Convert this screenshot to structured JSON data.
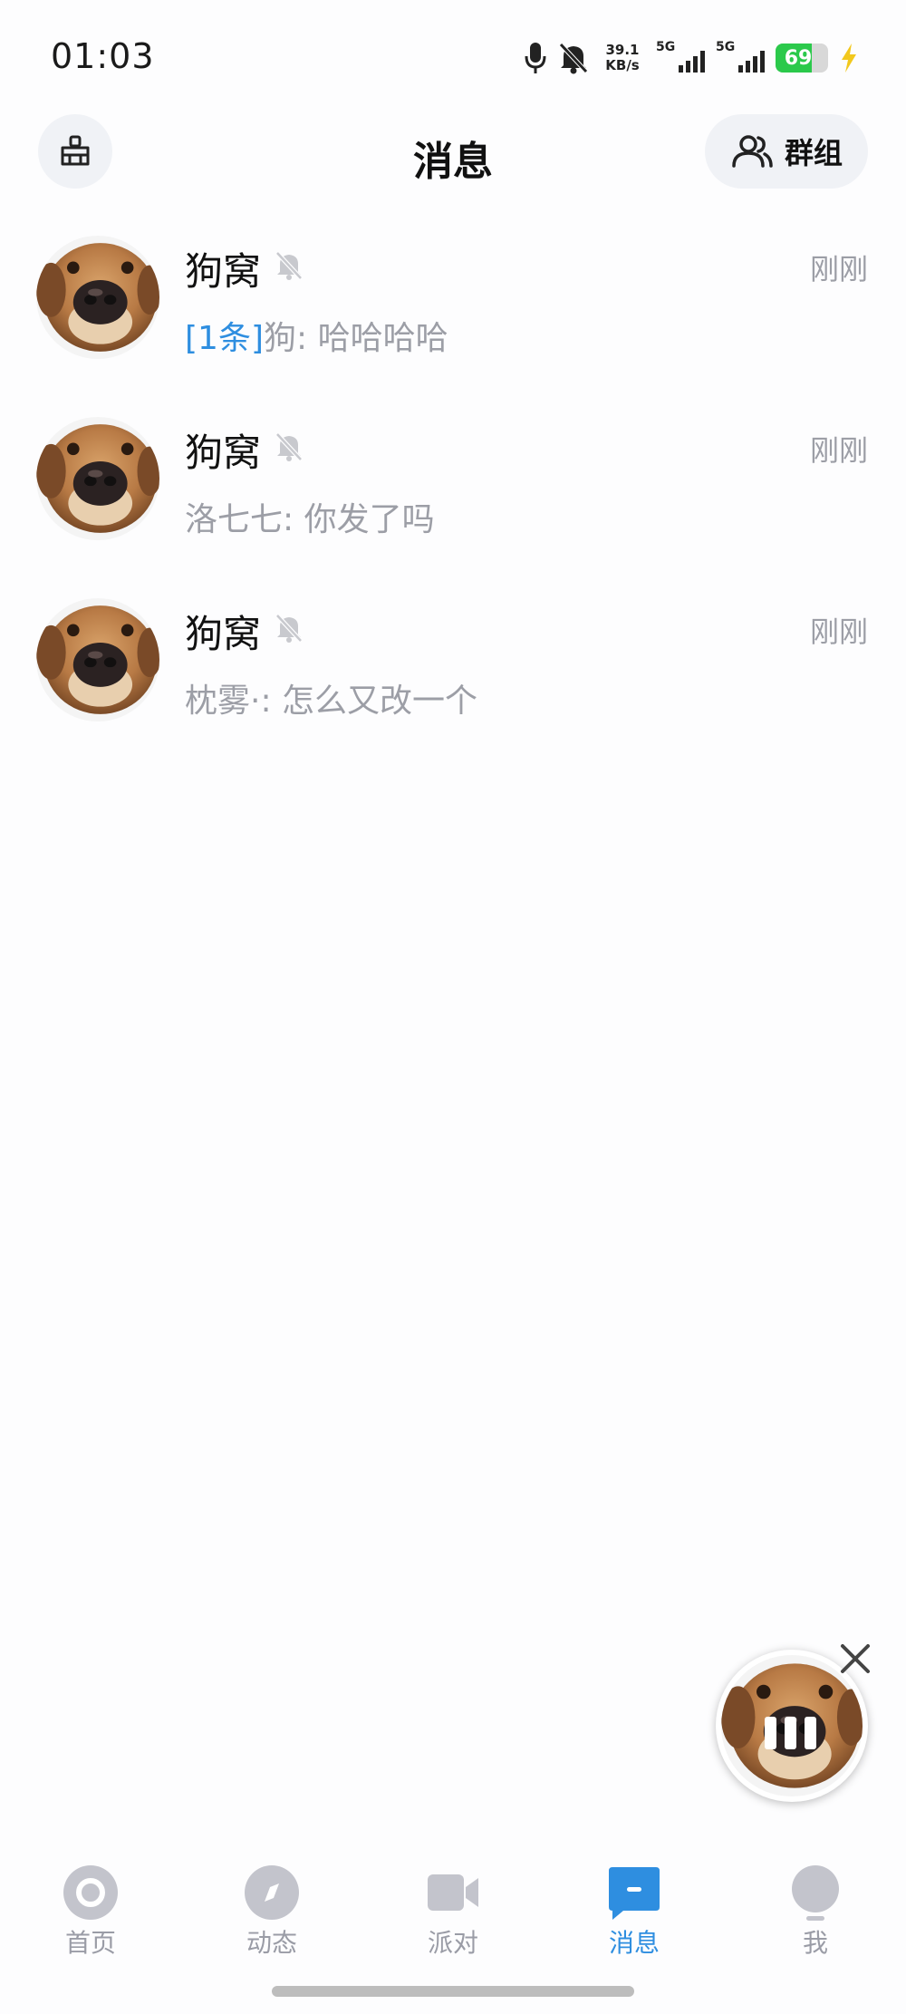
{
  "status_bar": {
    "time": "01:03",
    "net_speed_value": "39.1",
    "net_speed_unit": "KB/s",
    "sim1_label": "5G",
    "sim2_label": "5G",
    "battery_percent": "69",
    "battery_level": 0.69,
    "icons": [
      "microphone-icon",
      "bell-muted-icon",
      "charging-bolt-icon"
    ]
  },
  "header": {
    "title": "消息",
    "groups_label": "群组",
    "left_icon": "broom-icon",
    "groups_icon": "group-icon"
  },
  "conversations": [
    {
      "name": "狗窝",
      "time": "刚刚",
      "unread_tag": "[1条]",
      "sender": "狗",
      "message": "哈哈哈哈",
      "muted": true
    },
    {
      "name": "狗窝",
      "time": "刚刚",
      "unread_tag": "",
      "sender": "洛七七",
      "message": "你发了吗",
      "muted": true
    },
    {
      "name": "狗窝",
      "time": "刚刚",
      "unread_tag": "",
      "sender": "枕雾·",
      "message": "怎么又改一个",
      "muted": true
    }
  ],
  "floating_player": {
    "state": "paused-bars",
    "icon": "pause-icon"
  },
  "bottom_nav": {
    "items": [
      {
        "label": "首页",
        "icon": "home-ring-icon",
        "active": false
      },
      {
        "label": "动态",
        "icon": "compass-icon",
        "active": false
      },
      {
        "label": "派对",
        "icon": "video-camera-icon",
        "active": false
      },
      {
        "label": "消息",
        "icon": "chat-bubble-icon",
        "active": true
      },
      {
        "label": "我",
        "icon": "profile-icon",
        "active": false
      }
    ]
  },
  "colors": {
    "accent": "#2e8ee0",
    "muted_text": "#9c9ea6",
    "battery": "#2bc94b",
    "nav_inactive": "#c3c4cc"
  }
}
